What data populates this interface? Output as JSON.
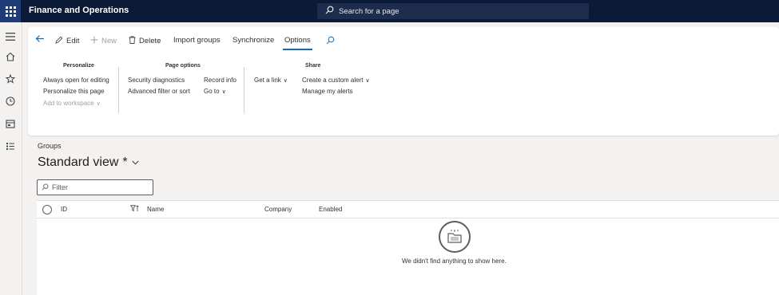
{
  "app": {
    "title": "Finance and Operations"
  },
  "search": {
    "label": "Search for a page"
  },
  "toolbar": {
    "edit": "Edit",
    "new": "New",
    "delete": "Delete",
    "import_groups": "Import groups",
    "synchronize": "Synchronize",
    "options": "Options"
  },
  "groups": {
    "personalize": {
      "title": "Personalize",
      "items": [
        "Always open for editing",
        "Personalize this page",
        "Add to workspace"
      ]
    },
    "page_options": {
      "title": "Page options",
      "col1": [
        "Security diagnostics",
        "Advanced filter or sort"
      ],
      "col2": [
        "Record info",
        "Go to"
      ]
    },
    "share": {
      "title": "Share",
      "get_link": "Get a link",
      "col2": [
        "Create a custom alert",
        "Manage my alerts"
      ]
    }
  },
  "content": {
    "breadcrumb": "Groups",
    "view_title": "Standard view",
    "modified_marker": "*",
    "filter_placeholder": "Filter"
  },
  "grid": {
    "columns": [
      "ID",
      "Name",
      "Company",
      "Enabled"
    ],
    "empty_message": "We didn't find anything to show here."
  },
  "colors": {
    "topbar": "#0b1a36",
    "accent": "#0f6cbd",
    "disabled_text": "#a19f9d"
  },
  "icons": {
    "app_launcher": "waffle-icon",
    "search": "search-icon",
    "back": "back-arrow-icon",
    "edit": "pencil-icon",
    "new": "plus-icon",
    "delete": "trash-icon",
    "find": "search-icon",
    "empty_state": "empty-folder-icon"
  }
}
